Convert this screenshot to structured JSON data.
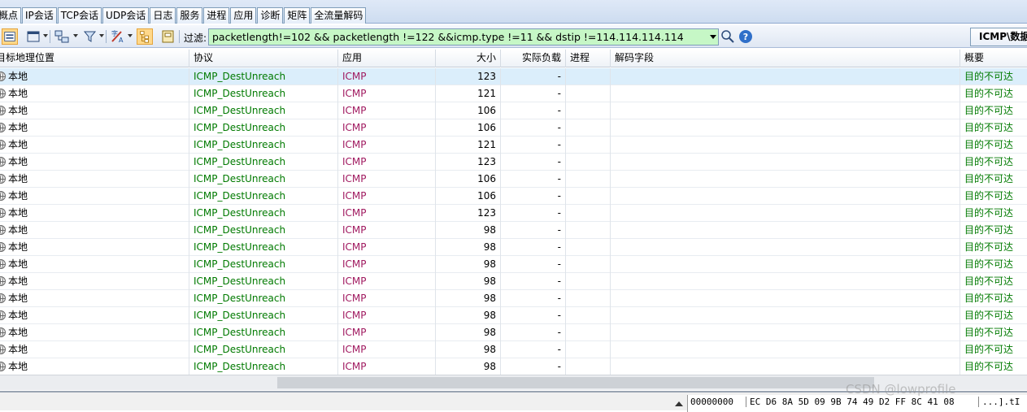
{
  "tabs": [
    "概点",
    "IP会话",
    "TCP会话",
    "UDP会话",
    "日志",
    "服务",
    "进程",
    "应用",
    "诊断",
    "矩阵",
    "全流量解码"
  ],
  "toolbar": {
    "filter_label": "过滤:",
    "filter_value": "packetlength!=102 && packetlength !=122 &&icmp.type !=11 && dstip !=114.114.114.114",
    "right_tab": "ICMP\\数据"
  },
  "table": {
    "headers": {
      "dest": "目标地理位置",
      "proto": "协议",
      "app": "应用",
      "size": "大小",
      "payload": "实际负载",
      "process": "进程",
      "decode": "解码字段",
      "summary": "概要"
    },
    "rows": [
      {
        "dest": "本地",
        "proto": "ICMP_DestUnreach",
        "app": "ICMP",
        "size": "123",
        "payload": "-",
        "process": "",
        "decode": "",
        "summary": "目的不可达"
      },
      {
        "dest": "本地",
        "proto": "ICMP_DestUnreach",
        "app": "ICMP",
        "size": "121",
        "payload": "-",
        "process": "",
        "decode": "",
        "summary": "目的不可达"
      },
      {
        "dest": "本地",
        "proto": "ICMP_DestUnreach",
        "app": "ICMP",
        "size": "106",
        "payload": "-",
        "process": "",
        "decode": "",
        "summary": "目的不可达"
      },
      {
        "dest": "本地",
        "proto": "ICMP_DestUnreach",
        "app": "ICMP",
        "size": "106",
        "payload": "-",
        "process": "",
        "decode": "",
        "summary": "目的不可达"
      },
      {
        "dest": "本地",
        "proto": "ICMP_DestUnreach",
        "app": "ICMP",
        "size": "121",
        "payload": "-",
        "process": "",
        "decode": "",
        "summary": "目的不可达"
      },
      {
        "dest": "本地",
        "proto": "ICMP_DestUnreach",
        "app": "ICMP",
        "size": "123",
        "payload": "-",
        "process": "",
        "decode": "",
        "summary": "目的不可达"
      },
      {
        "dest": "本地",
        "proto": "ICMP_DestUnreach",
        "app": "ICMP",
        "size": "106",
        "payload": "-",
        "process": "",
        "decode": "",
        "summary": "目的不可达"
      },
      {
        "dest": "本地",
        "proto": "ICMP_DestUnreach",
        "app": "ICMP",
        "size": "106",
        "payload": "-",
        "process": "",
        "decode": "",
        "summary": "目的不可达"
      },
      {
        "dest": "本地",
        "proto": "ICMP_DestUnreach",
        "app": "ICMP",
        "size": "123",
        "payload": "-",
        "process": "",
        "decode": "",
        "summary": "目的不可达"
      },
      {
        "dest": "本地",
        "proto": "ICMP_DestUnreach",
        "app": "ICMP",
        "size": "98",
        "payload": "-",
        "process": "",
        "decode": "",
        "summary": "目的不可达"
      },
      {
        "dest": "本地",
        "proto": "ICMP_DestUnreach",
        "app": "ICMP",
        "size": "98",
        "payload": "-",
        "process": "",
        "decode": "",
        "summary": "目的不可达"
      },
      {
        "dest": "本地",
        "proto": "ICMP_DestUnreach",
        "app": "ICMP",
        "size": "98",
        "payload": "-",
        "process": "",
        "decode": "",
        "summary": "目的不可达"
      },
      {
        "dest": "本地",
        "proto": "ICMP_DestUnreach",
        "app": "ICMP",
        "size": "98",
        "payload": "-",
        "process": "",
        "decode": "",
        "summary": "目的不可达"
      },
      {
        "dest": "本地",
        "proto": "ICMP_DestUnreach",
        "app": "ICMP",
        "size": "98",
        "payload": "-",
        "process": "",
        "decode": "",
        "summary": "目的不可达"
      },
      {
        "dest": "本地",
        "proto": "ICMP_DestUnreach",
        "app": "ICMP",
        "size": "98",
        "payload": "-",
        "process": "",
        "decode": "",
        "summary": "目的不可达"
      },
      {
        "dest": "本地",
        "proto": "ICMP_DestUnreach",
        "app": "ICMP",
        "size": "98",
        "payload": "-",
        "process": "",
        "decode": "",
        "summary": "目的不可达"
      },
      {
        "dest": "本地",
        "proto": "ICMP_DestUnreach",
        "app": "ICMP",
        "size": "98",
        "payload": "-",
        "process": "",
        "decode": "",
        "summary": "目的不可达"
      },
      {
        "dest": "本地",
        "proto": "ICMP_DestUnreach",
        "app": "ICMP",
        "size": "98",
        "payload": "-",
        "process": "",
        "decode": "",
        "summary": "目的不可达"
      }
    ]
  },
  "hex": {
    "offset": "00000000",
    "bytes": "EC D6 8A 5D 09 9B 74 49 D2 FF 8C 41 08",
    "ascii": "...].tI"
  },
  "watermark": "CSDN @lowprofile"
}
